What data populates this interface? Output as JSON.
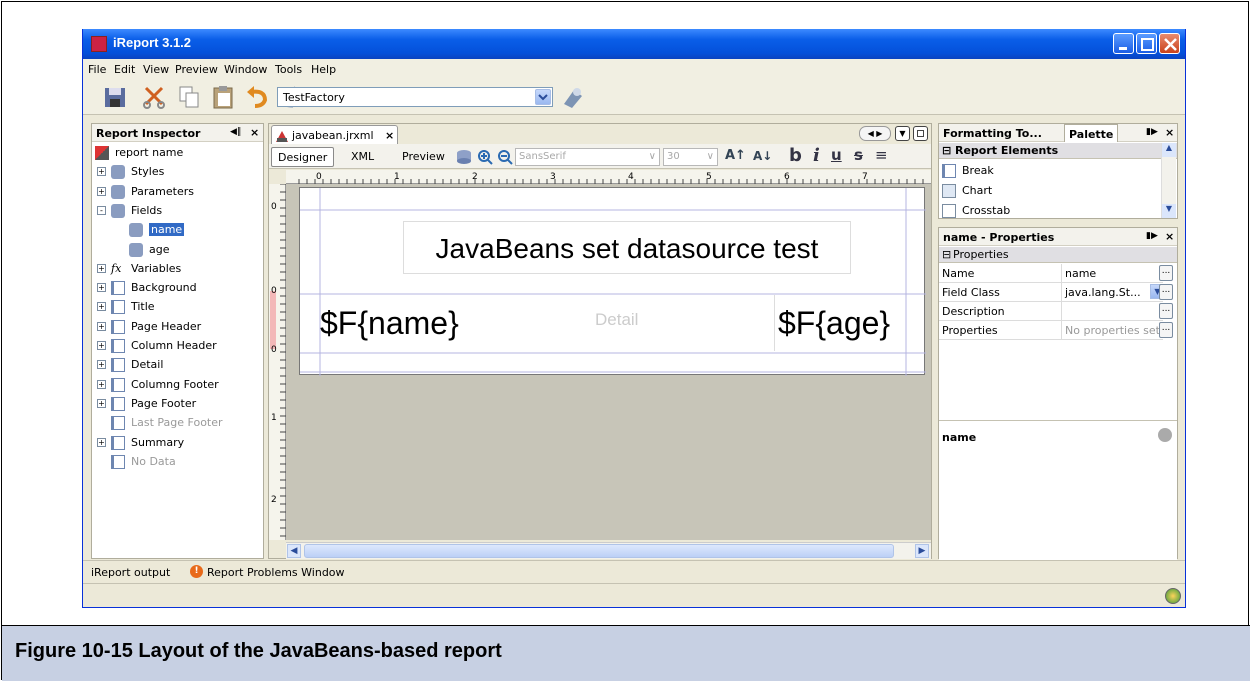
{
  "window": {
    "title": "iReport 3.1.2"
  },
  "menu": [
    "File",
    "Edit",
    "View",
    "Preview",
    "Window",
    "Tools",
    "Help"
  ],
  "toolbar": {
    "combo_value": "TestFactory",
    "icons": [
      "save-icon",
      "cut-icon",
      "copy-icon",
      "paste-icon",
      "undo-icon",
      "redo-icon",
      "run-report-icon"
    ]
  },
  "inspector": {
    "title": "Report Inspector",
    "items": [
      {
        "label": "report name",
        "icon": "report-icon",
        "expander": ""
      },
      {
        "label": "Styles",
        "icon": "styles-icon",
        "expander": "+"
      },
      {
        "label": "Parameters",
        "icon": "parameters-icon",
        "expander": "+"
      },
      {
        "label": "Fields",
        "icon": "fields-icon",
        "expander": "-"
      },
      {
        "label": "name",
        "icon": "field-icon",
        "expander": ""
      },
      {
        "label": "age",
        "icon": "field-icon",
        "expander": ""
      },
      {
        "label": "Variables",
        "icon": "variables-icon",
        "expander": "+"
      },
      {
        "label": "Background",
        "icon": "band-icon",
        "expander": "+"
      },
      {
        "label": "Title",
        "icon": "band-icon",
        "expander": "+"
      },
      {
        "label": "Page Header",
        "icon": "band-icon",
        "expander": "+"
      },
      {
        "label": "Column Header",
        "icon": "band-icon",
        "expander": "+"
      },
      {
        "label": "Detail",
        "icon": "band-icon",
        "expander": "+"
      },
      {
        "label": "Columng Footer",
        "icon": "band-icon",
        "expander": "+"
      },
      {
        "label": "Page Footer",
        "icon": "band-icon",
        "expander": "+"
      },
      {
        "label": "Last Page Footer",
        "icon": "band-icon",
        "expander": ""
      },
      {
        "label": "Summary",
        "icon": "band-icon",
        "expander": "+"
      },
      {
        "label": "No Data",
        "icon": "band-icon",
        "expander": ""
      }
    ]
  },
  "editor": {
    "tab": "javabean.jrxml",
    "modes": [
      "Designer",
      "XML",
      "Preview"
    ],
    "font_name": "SansSerif",
    "font_size": "30",
    "ruler": [
      "0",
      "1",
      "2",
      "3",
      "4",
      "5",
      "6",
      "7"
    ],
    "vruler": [
      "0",
      "0",
      "0",
      "1",
      "2"
    ],
    "report_title": "JavaBeans set datasource test",
    "field1": "$F{name}",
    "field2": "$F{age}",
    "band_label": "Detail"
  },
  "palette": {
    "tabs": [
      "Formatting To...",
      "Palette"
    ],
    "group": "Report Elements",
    "items": [
      "Break",
      "Chart",
      "Crosstab"
    ]
  },
  "properties": {
    "title": "name - Properties",
    "group": "Properties",
    "rows": [
      {
        "key": "Name",
        "value": "name"
      },
      {
        "key": "Field Class",
        "value": "java.lang.St..."
      },
      {
        "key": "Description",
        "value": ""
      },
      {
        "key": "Properties",
        "value": "No properties set"
      }
    ],
    "footer": "name"
  },
  "bottom": {
    "output": "iReport output",
    "problems": "Report Problems Window"
  },
  "caption": "Figure 10-15  Layout of the JavaBeans-based report"
}
